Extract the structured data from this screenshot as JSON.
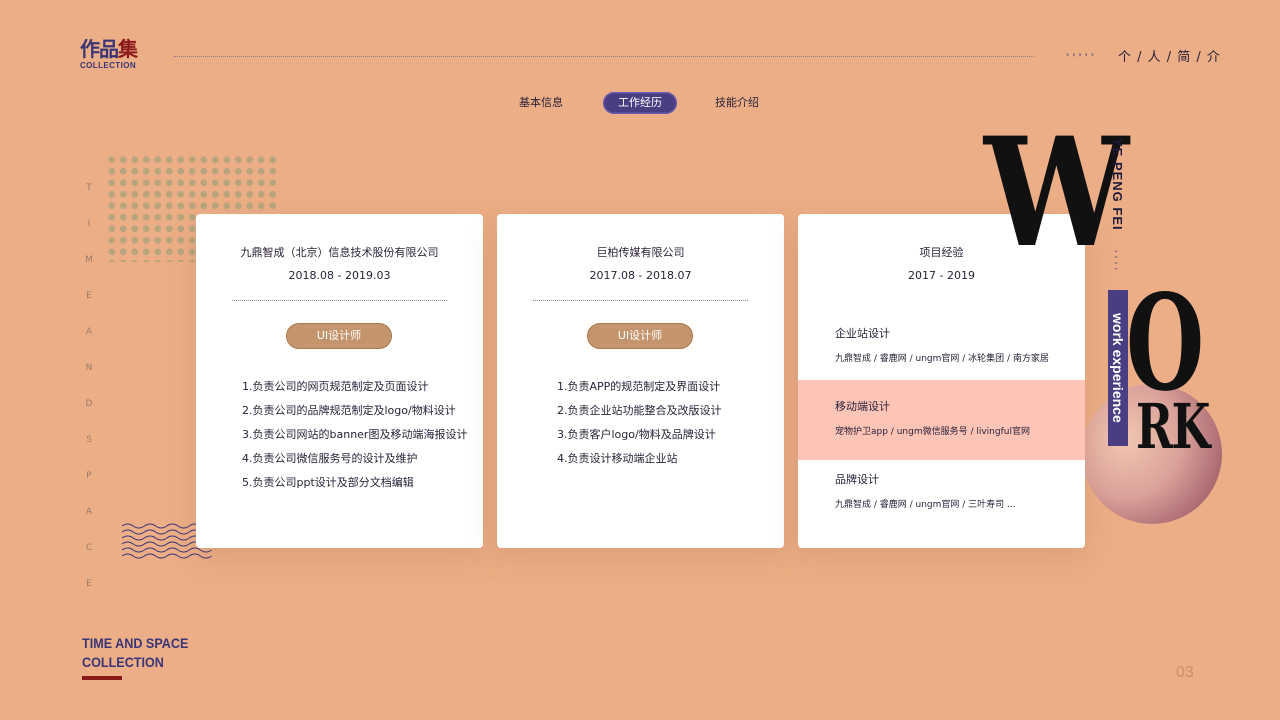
{
  "logo": {
    "title_main": "作品",
    "title_accent": "集",
    "subtitle": "COLLECTION"
  },
  "header": {
    "arrows": "›››››",
    "title": "个 / 人 / 简 / 介"
  },
  "tabs": [
    {
      "label": "基本信息",
      "active": false
    },
    {
      "label": "工作经历",
      "active": true
    },
    {
      "label": "技能介绍",
      "active": false
    }
  ],
  "side_text": [
    "T",
    "I",
    "M",
    "E",
    "",
    "A",
    "N",
    "D",
    "",
    "S",
    "P",
    "A",
    "C",
    "E"
  ],
  "cards": [
    {
      "company": "九鼎智成（北京）信息技术股份有限公司",
      "period": "2018.08 - 2019.03",
      "role": "UI设计师",
      "duties": [
        "1.负责公司的网页规范制定及页面设计",
        "2.负责公司的品牌规范制定及logo/物料设计",
        "3.负责公司网站的banner图及移动端海报设计",
        "4.负责公司微信服务号的设计及维护",
        "5.负责公司ppt设计及部分文档编辑"
      ]
    },
    {
      "company": "巨柏传媒有限公司",
      "period": "2017.08 - 2018.07",
      "role": "UI设计师",
      "duties": [
        "1.负责APP的规范制定及界面设计",
        "2.负责企业站功能整合及改版设计",
        "3.负责客户logo/物料及品牌设计",
        "4.负责设计移动端企业站"
      ]
    }
  ],
  "projects_card": {
    "title": "项目经验",
    "period": "2017 - 2019",
    "items": [
      {
        "name": "企业站设计",
        "detail": "九鼎智成 / 睿鹿网 / ungm官网 / 冰轮集团 / 南方家居",
        "highlight": false
      },
      {
        "name": "移动端设计",
        "detail": "宠物护卫app / ungm微信服务号 / livingful官网",
        "highlight": true
      },
      {
        "name": "品牌设计",
        "detail": "九鼎智成 / 睿鹿网 / ungm官网 / 三叶寿司 ...",
        "highlight": false
      }
    ]
  },
  "decor": {
    "letter_w": "W",
    "letter_o": "O",
    "letters_rk": "RK",
    "vertical_name": "YE PENG FEI",
    "vertical_arrows": "››››",
    "vertical_band": "work experience"
  },
  "footer": {
    "line1": "TIME AND SPACE",
    "line2": "COLLECTION",
    "page": "03"
  },
  "colors": {
    "background": "#ecae86",
    "accent": "#4a3d82",
    "highlight": "#fec4b6",
    "role_pill": "#c4956c",
    "brand_red": "#8b1a1a"
  }
}
